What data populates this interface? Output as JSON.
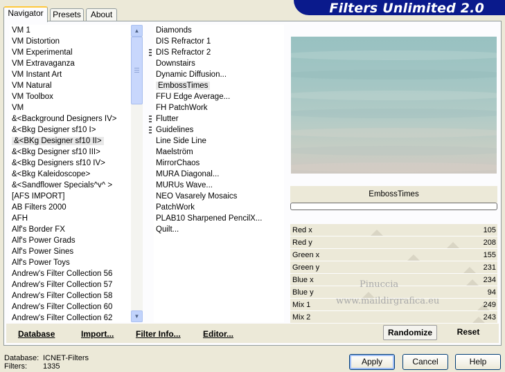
{
  "app": {
    "title": "Filters Unlimited 2.0"
  },
  "tabs": [
    {
      "label": "Navigator",
      "active": true
    },
    {
      "label": "Presets",
      "active": false
    },
    {
      "label": "About",
      "active": false
    }
  ],
  "categories": [
    {
      "label": "VM 1"
    },
    {
      "label": "VM Distortion"
    },
    {
      "label": "VM Experimental"
    },
    {
      "label": "VM Extravaganza"
    },
    {
      "label": "VM Instant Art"
    },
    {
      "label": "VM Natural"
    },
    {
      "label": "VM Toolbox"
    },
    {
      "label": "VM"
    },
    {
      "label": "&<Background Designers IV>"
    },
    {
      "label": "&<Bkg Designer sf10 I>"
    },
    {
      "label": "&<BKg Designer sf10 II>",
      "selected": true
    },
    {
      "label": "&<Bkg Designer sf10 III>"
    },
    {
      "label": "&<Bkg Designers sf10 IV>"
    },
    {
      "label": "&<Bkg Kaleidoscope>"
    },
    {
      "label": "&<Sandflower Specials^v^ >"
    },
    {
      "label": "[AFS IMPORT]"
    },
    {
      "label": "AB Filters 2000"
    },
    {
      "label": "AFH"
    },
    {
      "label": "Alf's Border FX"
    },
    {
      "label": "Alf's Power Grads"
    },
    {
      "label": "Alf's Power Sines"
    },
    {
      "label": "Alf's Power Toys"
    },
    {
      "label": "Andrew's Filter Collection 56"
    },
    {
      "label": "Andrew's Filter Collection 57"
    },
    {
      "label": "Andrew's Filter Collection 58"
    },
    {
      "label": "Andrew's Filter Collection 60"
    },
    {
      "label": "Andrew's Filter Collection 62"
    }
  ],
  "filters": [
    {
      "label": "Diamonds"
    },
    {
      "label": "DIS Refractor 1"
    },
    {
      "label": "DIS Refractor 2",
      "marker": true
    },
    {
      "label": "Downstairs"
    },
    {
      "label": "Dynamic Diffusion..."
    },
    {
      "label": "EmbossTimes",
      "selected": true
    },
    {
      "label": "FFU Edge Average..."
    },
    {
      "label": "FH PatchWork"
    },
    {
      "label": "Flutter",
      "marker": true
    },
    {
      "label": "Guidelines",
      "marker": true
    },
    {
      "label": "Line Side Line"
    },
    {
      "label": "Maelström"
    },
    {
      "label": "MirrorChaos"
    },
    {
      "label": "MURA Diagonal..."
    },
    {
      "label": "MURUs Wave..."
    },
    {
      "label": "NEO Vasarely Mosaics"
    },
    {
      "label": "PatchWork"
    },
    {
      "label": "PLAB10 Sharpened PencilX..."
    },
    {
      "label": "Quilt..."
    }
  ],
  "preview": {
    "filter_name": "EmbossTimes",
    "progress": 0
  },
  "parameters": [
    {
      "label": "Red x",
      "value": 105
    },
    {
      "label": "Red y",
      "value": 208
    },
    {
      "label": "Green x",
      "value": 155
    },
    {
      "label": "Green y",
      "value": 231
    },
    {
      "label": "Blue x",
      "value": 234
    },
    {
      "label": "Blue y",
      "value": 94
    },
    {
      "label": "Mix 1",
      "value": 249
    },
    {
      "label": "Mix 2",
      "value": 243
    }
  ],
  "actions": {
    "database": "Database",
    "import": "Import...",
    "filter_info": "Filter Info...",
    "editor": "Editor...",
    "randomize": "Randomize",
    "reset": "Reset"
  },
  "info": {
    "database_label": "Database:",
    "database_value": "ICNET-Filters",
    "filters_label": "Filters:",
    "filters_value": "1335"
  },
  "buttons": {
    "apply": "Apply",
    "cancel": "Cancel",
    "help": "Help"
  },
  "watermark": {
    "line1": "Pinuccia",
    "line2": "www.maildirgrafica.eu"
  }
}
